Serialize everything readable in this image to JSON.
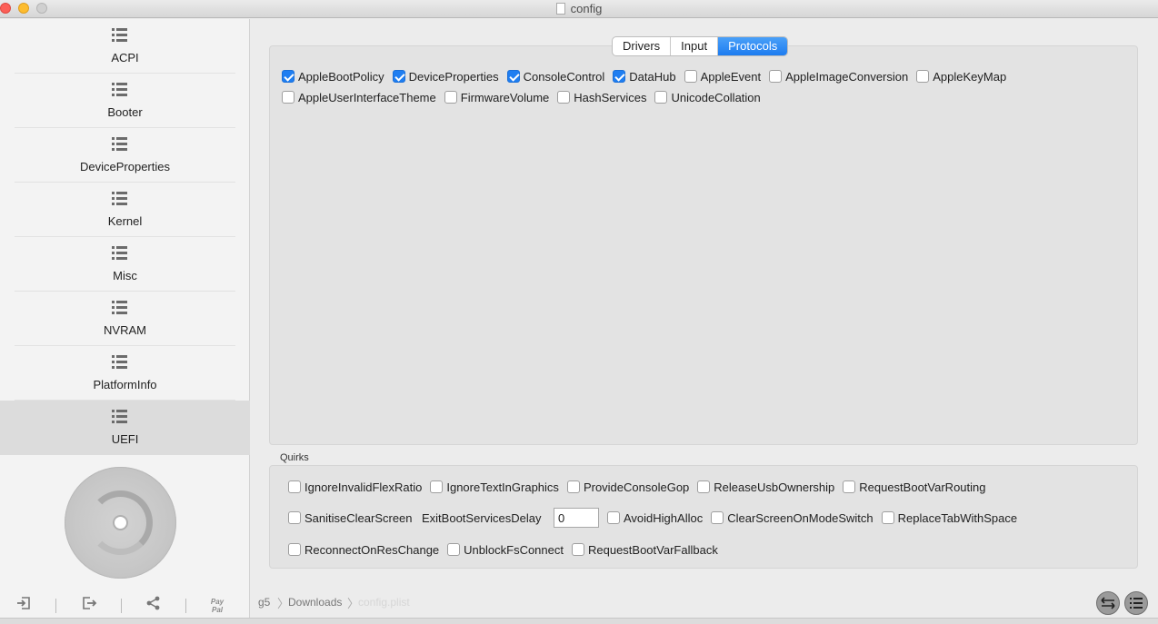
{
  "window": {
    "title": "config"
  },
  "sidebar": {
    "items": [
      {
        "label": "ACPI",
        "icon": "list-icon"
      },
      {
        "label": "Booter",
        "icon": "list-icon"
      },
      {
        "label": "DeviceProperties",
        "icon": "list-icon"
      },
      {
        "label": "Kernel",
        "icon": "list-icon"
      },
      {
        "label": "Misc",
        "icon": "list-icon"
      },
      {
        "label": "NVRAM",
        "icon": "list-icon"
      },
      {
        "label": "PlatformInfo",
        "icon": "list-icon"
      },
      {
        "label": "UEFI",
        "icon": "list-icon",
        "active": true
      }
    ],
    "toolbar": {
      "paypal_line1": "Pay",
      "paypal_line2": "Pal"
    }
  },
  "tabs": [
    {
      "label": "Drivers",
      "selected": false
    },
    {
      "label": "Input",
      "selected": false
    },
    {
      "label": "Protocols",
      "selected": true
    }
  ],
  "protocols": [
    {
      "label": "AppleBootPolicy",
      "checked": true
    },
    {
      "label": "DeviceProperties",
      "checked": true
    },
    {
      "label": "ConsoleControl",
      "checked": true
    },
    {
      "label": "DataHub",
      "checked": true
    },
    {
      "label": "AppleEvent",
      "checked": false
    },
    {
      "label": "AppleImageConversion",
      "checked": false
    },
    {
      "label": "AppleKeyMap",
      "checked": false
    },
    {
      "label": "AppleUserInterfaceTheme",
      "checked": false
    },
    {
      "label": "FirmwareVolume",
      "checked": false
    },
    {
      "label": "HashServices",
      "checked": false
    },
    {
      "label": "UnicodeCollation",
      "checked": false
    }
  ],
  "quirks": {
    "title": "Quirks",
    "row1": [
      {
        "label": "IgnoreInvalidFlexRatio",
        "checked": false
      },
      {
        "label": "IgnoreTextInGraphics",
        "checked": false
      },
      {
        "label": "ProvideConsoleGop",
        "checked": false
      },
      {
        "label": "ReleaseUsbOwnership",
        "checked": false
      },
      {
        "label": "RequestBootVarRouting",
        "checked": false
      }
    ],
    "sanitise": {
      "label": "SanitiseClearScreen",
      "checked": false
    },
    "exit_delay_label": "ExitBootServicesDelay",
    "exit_delay_value": "0",
    "row2_rest": [
      {
        "label": "AvoidHighAlloc",
        "checked": false
      },
      {
        "label": "ClearScreenOnModeSwitch",
        "checked": false
      },
      {
        "label": "ReplaceTabWithSpace",
        "checked": false
      }
    ],
    "row3": [
      {
        "label": "ReconnectOnResChange",
        "checked": false
      },
      {
        "label": "UnblockFsConnect",
        "checked": false
      },
      {
        "label": "RequestBootVarFallback",
        "checked": false
      }
    ]
  },
  "path": {
    "items": [
      "g5",
      "Downloads",
      "config.plist"
    ]
  }
}
